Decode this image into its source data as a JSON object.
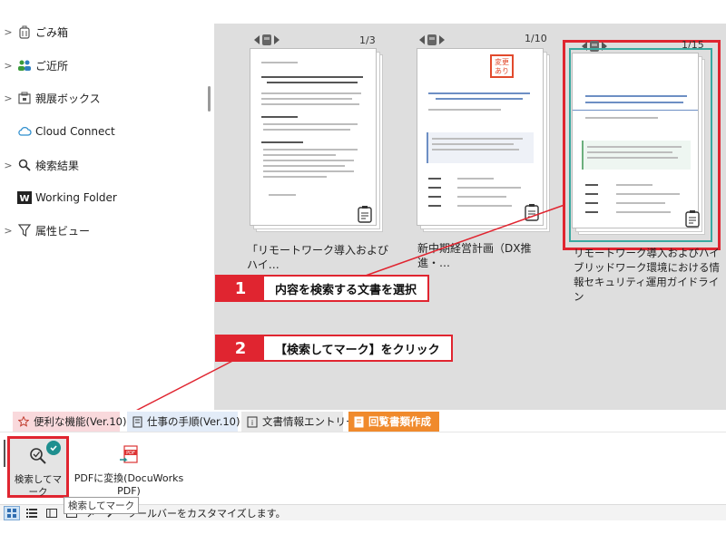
{
  "sidebar": {
    "items": [
      {
        "label": "ごみ箱",
        "icon": "trash-icon",
        "expandable": true
      },
      {
        "label": "ご近所",
        "icon": "neighbors-icon",
        "expandable": true
      },
      {
        "label": "親展ボックス",
        "icon": "confidential-box-icon",
        "expandable": true
      },
      {
        "label": "Cloud Connect",
        "icon": "cloud-icon",
        "expandable": false
      },
      {
        "label": "検索結果",
        "icon": "search-icon",
        "expandable": true
      },
      {
        "label": "Working Folder",
        "icon": "working-folder-icon",
        "expandable": false
      },
      {
        "label": "属性ビュー",
        "icon": "filter-icon",
        "expandable": true
      }
    ]
  },
  "documents": [
    {
      "title": "「リモートワーク導入およびハイ…",
      "page": "1/3"
    },
    {
      "title": "新中期経営計画（DX推進・…",
      "page": "1/10",
      "stamp": "変更あり"
    },
    {
      "title": "リモートワーク導入およびハイブリッドワーク環境における情報セキュリティ運用ガイドライン",
      "page": "1/15",
      "selected": true
    }
  ],
  "callouts": [
    {
      "num": "1",
      "text": "内容を検索する文書を選択"
    },
    {
      "num": "2",
      "text": "【検索してマーク】をクリック"
    }
  ],
  "tabs": [
    {
      "label": "便利な機能(Ver.10)",
      "color": "#f9d9dc"
    },
    {
      "label": "仕事の手順(Ver.10)",
      "color": "#e3ecf8"
    },
    {
      "label": "文書情報エントリー",
      "color": "#e8e8e8"
    },
    {
      "label": "回覧書類作成",
      "color": "#f08a2c",
      "active": true
    }
  ],
  "ribbon": {
    "search_mark_label": "検索してマーク",
    "pdf_convert_label": "PDFに変換(DocuWorks PDF)"
  },
  "tooltip": "検索してマーク",
  "status": {
    "message": "ツールバーをカスタマイズします。"
  },
  "colors": {
    "accent_red": "#e02530",
    "active_tab_orange": "#f08a2c",
    "selection_teal": "#39a9a0",
    "check_teal": "#1f8f8f"
  }
}
